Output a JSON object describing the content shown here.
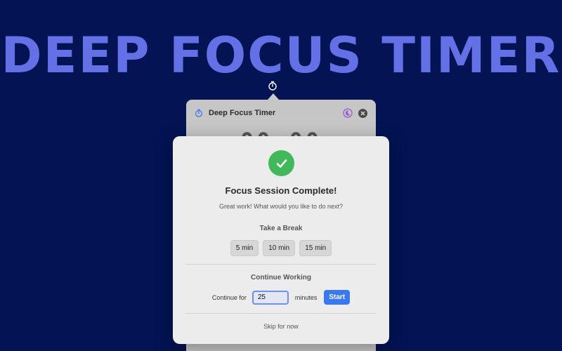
{
  "hero": {
    "title": "DEEP FOCUS TIMER"
  },
  "window": {
    "title": "Deep Focus Timer",
    "timer_display": "00:00"
  },
  "modal": {
    "title": "Focus Session Complete!",
    "subtitle": "Great work! What would you like to do next?",
    "break_section": {
      "label": "Take a Break",
      "options": [
        "5 min",
        "10 min",
        "15 min"
      ]
    },
    "continue_section": {
      "label": "Continue Working",
      "prefix": "Continue for",
      "minutes_value": "25",
      "suffix": "minutes",
      "start_label": "Start"
    },
    "skip_label": "Skip for now"
  },
  "colors": {
    "background": "#031353",
    "hero": "#6470e6",
    "success": "#41b85a",
    "accent": "#3a78f2"
  },
  "icons": {
    "menubar": "timer-icon",
    "window": "timer-icon",
    "theme": "moon-icon",
    "close": "close-icon",
    "success": "checkmark-icon"
  }
}
